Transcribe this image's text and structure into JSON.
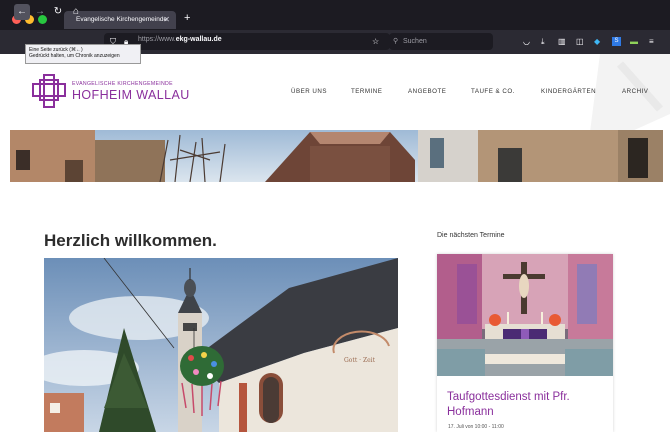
{
  "browser": {
    "tab_title": "Evangelische Kirchengemeinde",
    "new_tab": "+",
    "url_prefix": "https://www.",
    "url_domain": "ekg-wallau.de",
    "search_placeholder": "Suchen",
    "tooltip_line1": "Eine Seite zurück (⌘←)",
    "tooltip_line2": "Gedrückt halten, um Chronik anzuzeigen"
  },
  "site": {
    "logo_subtitle": "EVANGELISCHE KIRCHENGEMEINDE",
    "logo_title": "HOFHEIM WALLAU",
    "menu": [
      "ÜBER UNS",
      "TERMINE",
      "ANGEBOTE",
      "TAUFE & CO.",
      "KINDERGÄRTEN",
      "ARCHIV"
    ]
  },
  "main": {
    "welcome": "Herzlich willkommen."
  },
  "sidebar": {
    "heading": "Die nächsten Termine",
    "event_title": "Taufgottesdienst mit Pfr. Hofmann",
    "event_date": "17. Juli von 10:00 - 11:00"
  },
  "colors": {
    "brand": "#8a2f9c",
    "chrome_dark": "#1c1b22",
    "chrome_toolbar": "#2b2a33"
  }
}
